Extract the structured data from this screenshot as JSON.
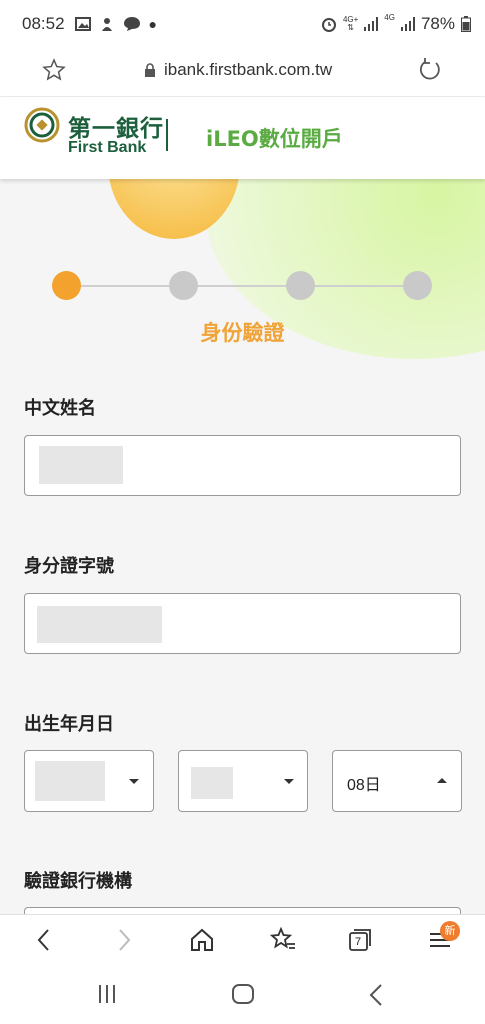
{
  "status_bar": {
    "time": "08:52",
    "net_1": "4G+",
    "net_2": "4G",
    "battery": "78%"
  },
  "browser": {
    "url": "ibank.firstbank.com.tw"
  },
  "site_header": {
    "bank_name_cn": "第一銀行",
    "bank_name_en": "First Bank",
    "page_title": "iLEO數位開戶"
  },
  "stepper": {
    "current_step_label": "身份驗證",
    "total_steps": 4,
    "current_step": 1
  },
  "form": {
    "name_label": "中文姓名",
    "id_label": "身分證字號",
    "birthday_label": "出生年月日",
    "day_value": "08日",
    "bank_label": "驗證銀行機構"
  },
  "toolbar": {
    "tabs_count": "7",
    "menu_badge": "新"
  },
  "colors": {
    "brand_green": "#1c5f3c",
    "title_green": "#5aab42",
    "accent_orange": "#f4a22e"
  }
}
